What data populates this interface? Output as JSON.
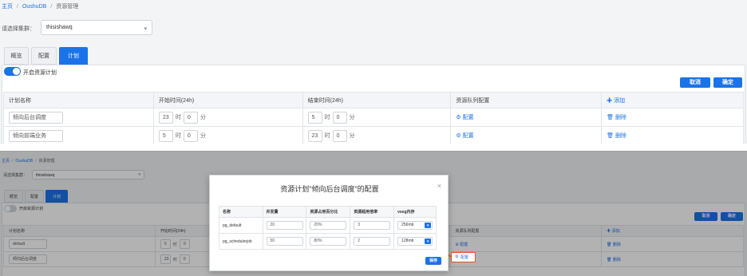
{
  "top": {
    "breadcrumb": [
      "主页",
      "OushuDB",
      "资源管理"
    ],
    "cluster": {
      "label": "请选择集群：",
      "value": "thisishawq"
    },
    "tabs": [
      "概览",
      "配置",
      "计划"
    ],
    "toggle_label": "开启资源计划",
    "buttons": {
      "cancel": "取消",
      "confirm": "确定"
    },
    "table": {
      "headers": [
        "计划名称",
        "开始时间(24h)",
        "结束时间(24h)",
        "资源队列配置",
        "添加"
      ],
      "rows": [
        {
          "name": "倾向后台调度",
          "start_h": "23",
          "start_m": "0",
          "end_h": "5",
          "end_m": "0",
          "config": "配置",
          "delete": "删除"
        },
        {
          "name": "倾向前端业务",
          "start_h": "5",
          "start_m": "0",
          "end_h": "23",
          "end_m": "0",
          "config": "配置",
          "delete": "删除"
        }
      ],
      "hour_label": "时",
      "min_label": "分"
    }
  },
  "bottom": {
    "breadcrumb": [
      "主页",
      "OushuDB",
      "资源管理"
    ],
    "cluster": {
      "label": "请选择集群：",
      "value": "thisishawq"
    },
    "tabs": [
      "概览",
      "配置",
      "计划"
    ],
    "toggle_label": "开启资源计划",
    "buttons": {
      "cancel": "取消",
      "confirm": "确定"
    },
    "table": {
      "headers": [
        "计划名称",
        "开始时间(24h)",
        "资源队列配置",
        "添加"
      ],
      "rows": [
        {
          "name": "default",
          "start_h": "5",
          "start_m": "0",
          "config": "配置",
          "delete": "删除"
        },
        {
          "name": "倾向后台调度",
          "start_h": "23",
          "start_m": "0",
          "config": "配置",
          "delete": "删除"
        }
      ],
      "hour_label": "时",
      "min_label": "分"
    }
  },
  "modal": {
    "title": "资源计划\"倾向后台调度\"的配置",
    "close": "×",
    "headers": [
      "名称",
      "并发量",
      "资源占用百分比",
      "资源超用倍率",
      "vseg内存"
    ],
    "rows": [
      {
        "name": "pg_default",
        "concurrency": "20",
        "percent": "20%",
        "overuse": "3",
        "vseg": "256mb"
      },
      {
        "name": "pg_schedulerjob",
        "concurrency": "50",
        "percent": "80%",
        "overuse": "2",
        "vseg": "128mb"
      }
    ],
    "save": "保存"
  },
  "colors": {
    "accent": "#1a73e8",
    "highlight": "#e8501c",
    "background": "#f3f4f6"
  }
}
